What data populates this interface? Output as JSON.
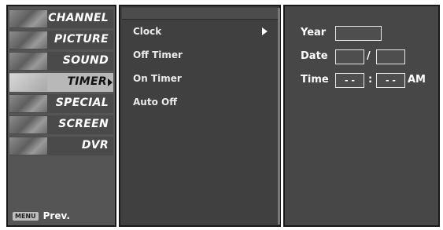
{
  "categories": [
    {
      "label": "CHANNEL",
      "icon": "channel-thumbnail"
    },
    {
      "label": "PICTURE",
      "icon": "picture-thumbnail"
    },
    {
      "label": "SOUND",
      "icon": "sound-thumbnail"
    },
    {
      "label": "TIMER",
      "icon": "timer-thumbnail",
      "active": true
    },
    {
      "label": "SPECIAL",
      "icon": "special-thumbnail"
    },
    {
      "label": "SCREEN",
      "icon": "screen-thumbnail"
    },
    {
      "label": "DVR",
      "icon": "dvr-thumbnail"
    }
  ],
  "footer": {
    "menu_key": "MENU",
    "prev_label": "Prev."
  },
  "submenu": {
    "items": [
      "Clock",
      "Off Timer",
      "On Timer",
      "Auto Off"
    ],
    "selected": "Clock"
  },
  "clock": {
    "year_label": "Year",
    "year_value": "",
    "date_label": "Date",
    "date_month": "",
    "date_separator": "/",
    "date_day": "",
    "time_label": "Time",
    "time_hour": "- -",
    "time_separator": ":",
    "time_minute": "- -",
    "time_ampm": "AM"
  },
  "colors": {
    "menu_background": "#555555",
    "active_item": "#b8b8b8",
    "panel_background": "#474747",
    "text": "#ffffff"
  }
}
